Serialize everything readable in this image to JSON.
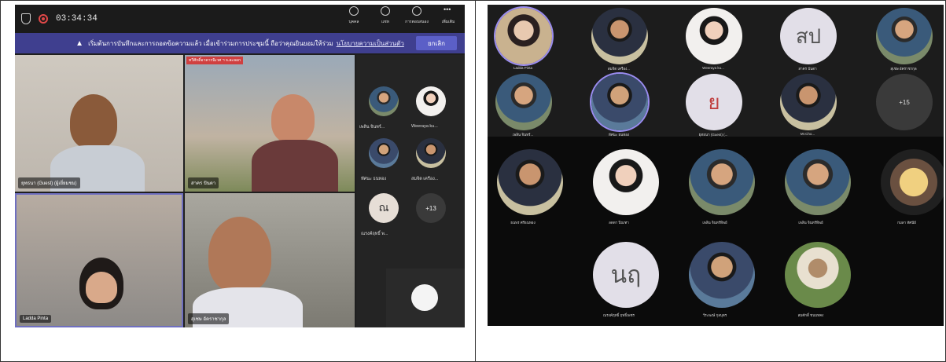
{
  "left": {
    "timer": "03:34:34",
    "toolbar": [
      {
        "label": "บุคคล",
        "icon": "people-icon"
      },
      {
        "label": "แชท",
        "icon": "chat-icon"
      },
      {
        "label": "การตอบสนอง",
        "icon": "reactions-icon"
      },
      {
        "label": "เพิ่มเติม",
        "icon": "more-icon"
      }
    ],
    "banner": {
      "text": "เริ่มต้นการบันทึกและการถอดข้อความแล้ว เมื่อเข้าร่วมการประชุมนี้ ถือว่าคุณยินยอมให้ร่วม",
      "link": "นโยบายความเป็นส่วนตัว",
      "button": "ยกเลิก"
    },
    "tiles": [
      {
        "name": "ยุทธนา (Guest) (ผู้เยี่ยมชม)"
      },
      {
        "name": "สาคร ปันตา",
        "tag": "ทวีศักดิ์อาคารนิเวศ ฯ จ.ละลอก"
      },
      {
        "name": "Ladda Pinta"
      },
      {
        "name": "สุเชษ อัคราชากุล"
      }
    ],
    "side": [
      {
        "name": "เพลิน จินทร์...",
        "type": "photo"
      },
      {
        "name": "Weeraya ku...",
        "type": "photo"
      },
      {
        "name": "ทัศนะ ธนทอง",
        "type": "photo"
      },
      {
        "name": "สมจิต เครือง...",
        "type": "photo"
      },
      {
        "name": "ณรงค์ฤทธิ์ พ...",
        "type": "letter",
        "letter": "ณ"
      },
      {
        "name": "",
        "type": "more",
        "letter": "+13"
      }
    ]
  },
  "right": {
    "row1": [
      {
        "name": "Ladda Pinta",
        "type": "photo"
      },
      {
        "name": "สมจิต เครือง...",
        "type": "photo"
      },
      {
        "name": "Weeraya ku...",
        "type": "photo"
      },
      {
        "name": "สาคร ปันตา",
        "type": "letter",
        "letter": "สป"
      },
      {
        "name": "สุเชษ อัคราชากุล",
        "type": "photo"
      }
    ],
    "row2": [
      {
        "name": "เพลิน จินทร์...",
        "type": "photo"
      },
      {
        "name": "ทัศนะ ธนทอง",
        "type": "photo"
      },
      {
        "name": "ยุทธนา (Guest) (...",
        "type": "letter",
        "letter": "ย"
      },
      {
        "name": "Mr.Cho...",
        "type": "photo"
      },
      {
        "name": "",
        "type": "more",
        "letter": "+15"
      }
    ],
    "row3": [
      {
        "name": "ธนพร ศรีธนทอง",
        "type": "photo"
      },
      {
        "name": "ลดดา ปิณฑา",
        "type": "photo"
      },
      {
        "name": "เพลิน จินทร์ทิพย์",
        "type": "photo"
      },
      {
        "name": "เพลิน จินทร์ทิพย์",
        "type": "photo"
      },
      {
        "name": "กมลา ทัศนีย์",
        "type": "photo"
      }
    ],
    "row4": [
      {
        "name": "ณรงค์ฤทธิ์ ฤทธิ์เพชร",
        "type": "letter",
        "letter": "นฤ"
      },
      {
        "name": "วีระพงษ์ กุลบุตร",
        "type": "photo"
      },
      {
        "name": "สมศักดิ์ ชนบทคง",
        "type": "photo"
      }
    ]
  }
}
